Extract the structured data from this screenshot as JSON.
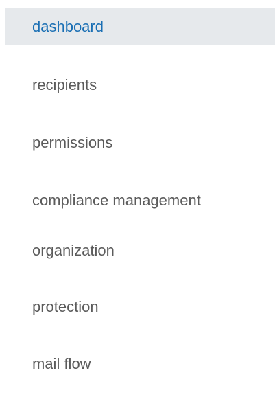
{
  "sidebar": {
    "colors": {
      "selected_background": "#e6e9ec",
      "selected_text": "#1a6fb4",
      "text": "#5b5b5b"
    },
    "items": [
      {
        "label": "dashboard",
        "selected": true
      },
      {
        "label": "recipients",
        "selected": false
      },
      {
        "label": "permissions",
        "selected": false
      },
      {
        "label": "compliance management",
        "selected": false
      },
      {
        "label": "organization",
        "selected": false
      },
      {
        "label": "protection",
        "selected": false
      },
      {
        "label": "mail flow",
        "selected": false
      }
    ]
  }
}
